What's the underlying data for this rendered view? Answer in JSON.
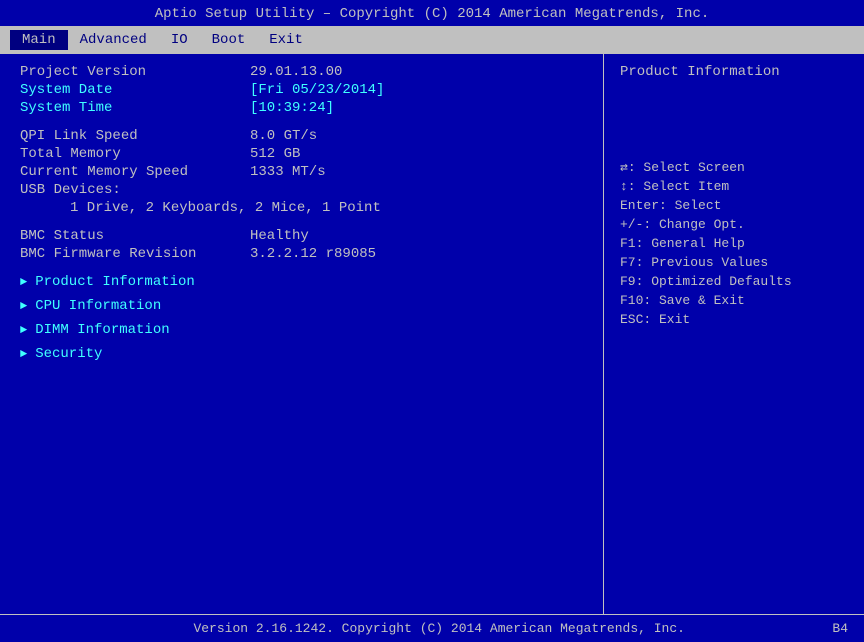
{
  "title_bar": {
    "text": "Aptio Setup Utility – Copyright (C) 2014 American Megatrends, Inc."
  },
  "menu": {
    "items": [
      {
        "label": "Main",
        "active": true
      },
      {
        "label": "Advanced",
        "active": false
      },
      {
        "label": "IO",
        "active": false
      },
      {
        "label": "Boot",
        "active": false
      },
      {
        "label": "Exit",
        "active": false
      }
    ]
  },
  "main_panel": {
    "rows": [
      {
        "label": "Project Version",
        "value": "29.01.13.00",
        "highlight_label": false,
        "highlight_value": false
      },
      {
        "label": "System Date",
        "value": "[Fri 05/23/2014]",
        "highlight_label": true,
        "highlight_value": true
      },
      {
        "label": "System Time",
        "value": "[10:39:24]",
        "highlight_label": true,
        "highlight_value": true
      }
    ],
    "hardware": [
      {
        "label": "QPI Link Speed",
        "value": "8.0 GT/s",
        "highlight_label": false
      },
      {
        "label": "Total Memory",
        "value": "512 GB",
        "highlight_label": false
      },
      {
        "label": "Current Memory Speed",
        "value": "1333 MT/s",
        "highlight_label": false
      },
      {
        "label": "USB Devices:",
        "value": "",
        "highlight_label": false
      }
    ],
    "usb_detail": "1 Drive, 2 Keyboards, 2 Mice, 1 Point",
    "bmc": [
      {
        "label": "BMC Status",
        "value": "Healthy",
        "highlight_label": false
      },
      {
        "label": "BMC Firmware Revision",
        "value": "3.2.2.12 r89085",
        "highlight_label": false
      }
    ],
    "nav_items": [
      {
        "label": "Product Information"
      },
      {
        "label": "CPU Information"
      },
      {
        "label": "DIMM Information"
      }
    ],
    "security_item": "Security"
  },
  "right_panel": {
    "product_info_title": "Product Information",
    "help_keys": [
      {
        "key": "↔: Select Screen"
      },
      {
        "key": "↕: Select Item"
      },
      {
        "key": "Enter: Select"
      },
      {
        "key": "+/-: Change Opt."
      },
      {
        "key": "F1: General Help"
      },
      {
        "key": "F7: Previous Values"
      },
      {
        "key": "F9: Optimized Defaults"
      },
      {
        "key": "F10: Save & Exit"
      },
      {
        "key": "ESC: Exit"
      }
    ]
  },
  "footer": {
    "text": "Version 2.16.1242. Copyright (C) 2014 American Megatrends, Inc.",
    "badge": "B4"
  }
}
